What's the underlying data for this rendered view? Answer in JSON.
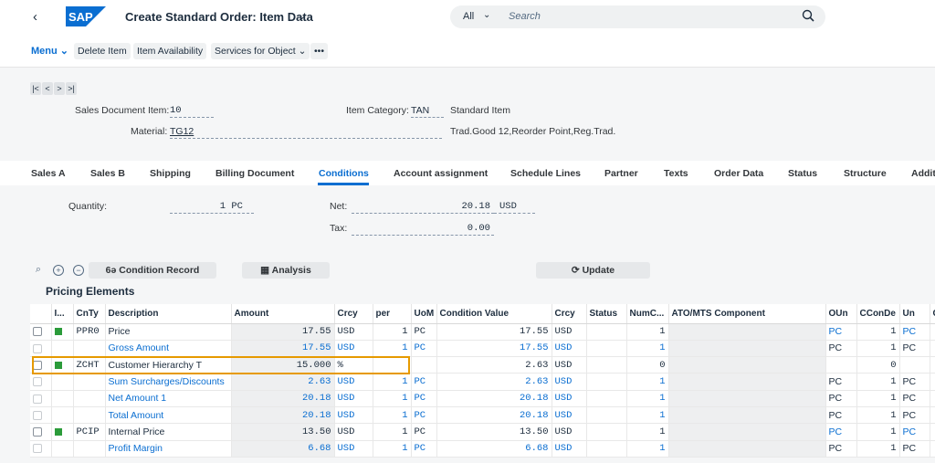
{
  "shell": {
    "back": "‹",
    "logo": "SAP",
    "title": "Create Standard Order: Item Data",
    "title_chevron": "⌄",
    "search_scope": "All",
    "search_placeholder": "Search"
  },
  "toolbar": {
    "menu": "Menu ⌄",
    "buttons": [
      "Delete Item",
      "Item Availability",
      "Services for Object ⌄",
      "•••"
    ]
  },
  "nav": [
    "|<",
    "<",
    ">",
    ">|"
  ],
  "header": {
    "sales_doc_item_label": "Sales Document Item:",
    "sales_doc_item_value": "10",
    "item_category_label": "Item Category:",
    "item_category_value": "TAN",
    "item_category_text": "Standard Item",
    "material_label": "Material:",
    "material_value": "TG12",
    "material_text": "Trad.Good 12,Reorder Point,Reg.Trad."
  },
  "tabs": [
    "Sales A",
    "Sales B",
    "Shipping",
    "Billing Document",
    "Conditions",
    "Account assignment",
    "Schedule Lines",
    "Partner",
    "Texts",
    "Order Data",
    "Status",
    "Structure",
    "Addit"
  ],
  "conditions": {
    "quantity_label": "Quantity:",
    "quantity_value": "1 PC",
    "net_label": "Net:",
    "net_value": "20.18",
    "net_currency": "USD",
    "tax_label": "Tax:",
    "tax_value": "0.00"
  },
  "pricing": {
    "zoom_icons": [
      "⌕",
      "+",
      "−"
    ],
    "condition_record": "6ə Condition Record",
    "analysis": "Analysis",
    "update": "Update",
    "title": "Pricing Elements",
    "columns": [
      "I...",
      "CnTy",
      "Description",
      "Amount",
      "Crcy",
      "per",
      "UoM",
      "Condition Value",
      "Crcy",
      "Status",
      "NumC...",
      "ATO/MTS Component",
      "OUn",
      "CConDe",
      "Un",
      "C"
    ],
    "rows": [
      {
        "type": "PPR0",
        "desc": "Price",
        "amount": "17.55",
        "crcy": "USD",
        "per": "1",
        "uom": "PC",
        "cval": "17.55",
        "ccrcy": "USD",
        "numc": "1",
        "oun": "PC",
        "ccon": "1",
        "un": "PC",
        "link": false,
        "editable": true
      },
      {
        "type": "",
        "desc": "Gross Amount",
        "amount": "17.55",
        "crcy": "USD",
        "per": "1",
        "uom": "PC",
        "cval": "17.55",
        "ccrcy": "USD",
        "numc": "1",
        "oun": "PC",
        "ccon": "1",
        "un": "PC",
        "link": true,
        "editable": false
      },
      {
        "type": "ZCHT",
        "desc": "Customer Hierarchy T",
        "amount": "15.000",
        "crcy": "%",
        "per": "",
        "uom": "",
        "cval": "2.63",
        "ccrcy": "USD",
        "numc": "0",
        "oun": "",
        "ccon": "0",
        "un": "",
        "link": false,
        "editable": true
      },
      {
        "type": "",
        "desc": "Sum Surcharges/Discounts",
        "amount": "2.63",
        "crcy": "USD",
        "per": "1",
        "uom": "PC",
        "cval": "2.63",
        "ccrcy": "USD",
        "numc": "1",
        "oun": "PC",
        "ccon": "1",
        "un": "PC",
        "link": true,
        "editable": false
      },
      {
        "type": "",
        "desc": "Net Amount 1",
        "amount": "20.18",
        "crcy": "USD",
        "per": "1",
        "uom": "PC",
        "cval": "20.18",
        "ccrcy": "USD",
        "numc": "1",
        "oun": "PC",
        "ccon": "1",
        "un": "PC",
        "link": true,
        "editable": false
      },
      {
        "type": "",
        "desc": "Total Amount",
        "amount": "20.18",
        "crcy": "USD",
        "per": "1",
        "uom": "PC",
        "cval": "20.18",
        "ccrcy": "USD",
        "numc": "1",
        "oun": "PC",
        "ccon": "1",
        "un": "PC",
        "link": true,
        "editable": false
      },
      {
        "type": "PCIP",
        "desc": "Internal Price",
        "amount": "13.50",
        "crcy": "USD",
        "per": "1",
        "uom": "PC",
        "cval": "13.50",
        "ccrcy": "USD",
        "numc": "1",
        "oun": "PC",
        "ccon": "1",
        "un": "PC",
        "link": false,
        "editable": true
      },
      {
        "type": "",
        "desc": "Profit Margin",
        "amount": "6.68",
        "crcy": "USD",
        "per": "1",
        "uom": "PC",
        "cval": "6.68",
        "ccrcy": "USD",
        "numc": "1",
        "oun": "PC",
        "ccon": "1",
        "un": "PC",
        "link": true,
        "editable": false
      }
    ]
  }
}
